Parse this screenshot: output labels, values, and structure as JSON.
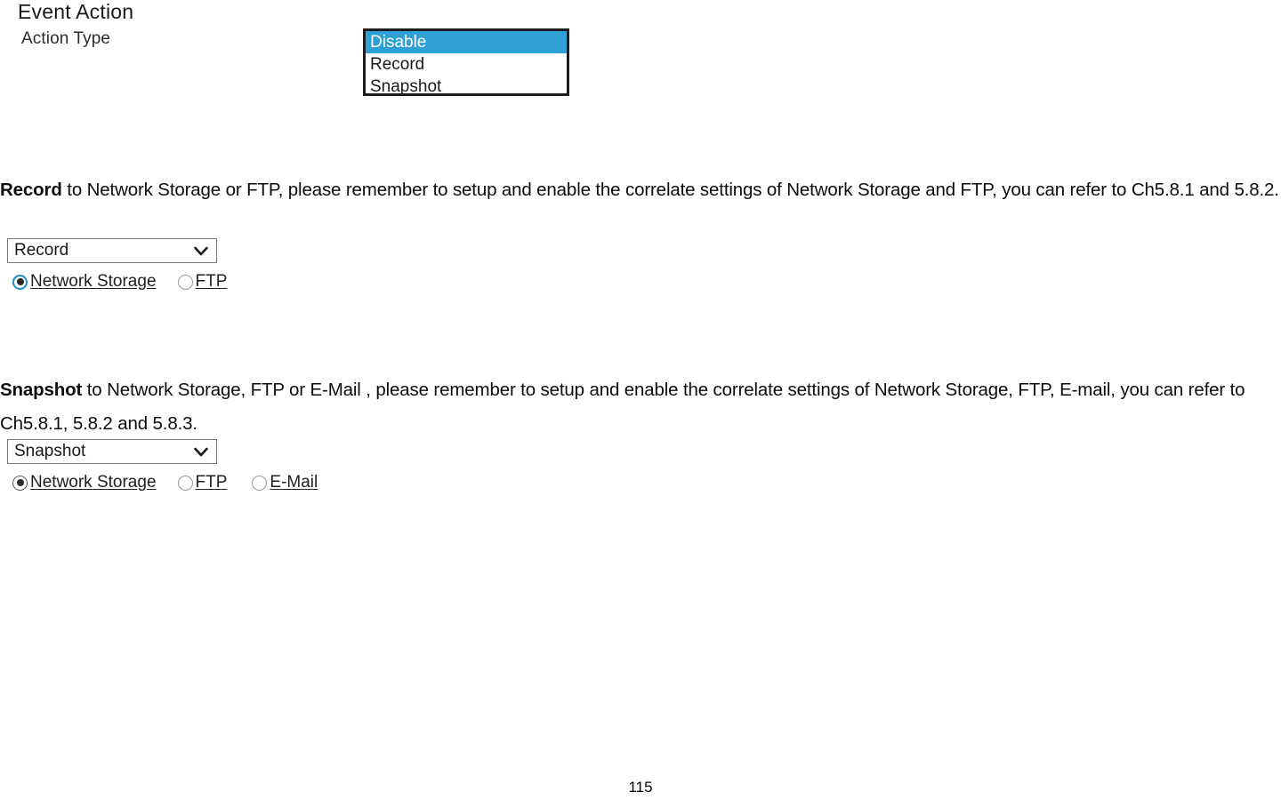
{
  "document": {
    "page_number": "115"
  },
  "ui_panel": {
    "heading": "Event Action",
    "field_label": "Action Type",
    "action_type_listbox": {
      "selected": "Disable",
      "options": [
        "Disable",
        "Record",
        "Snapshot"
      ],
      "highlight_color": "#2fa0d6",
      "highlight_text_color": "#ffffff",
      "border_color": "#1c1c1c"
    }
  },
  "sections": [
    {
      "id": "record",
      "paragraph": {
        "lead": "Record",
        "rest": " to Network Storage or FTP, please remember to setup and enable the correlate settings of Network Storage and FTP, you can refer to Ch5.8.1 and 5.8.2."
      },
      "select": {
        "value": "Record",
        "arrow_icon": "chevron-down-icon"
      },
      "radios": [
        {
          "label": "Network Storage",
          "checked": true,
          "style": "on-blue"
        },
        {
          "label": "FTP",
          "checked": false,
          "style": "off"
        }
      ]
    },
    {
      "id": "snapshot",
      "paragraph": {
        "lead": "Snapshot",
        "rest": " to Network Storage, FTP or E-Mail , please remember to setup and enable the correlate settings of Network Storage, FTP, E-mail, you can refer to Ch5.8.1, 5.8.2 and 5.8.3."
      },
      "select": {
        "value": "Snapshot",
        "arrow_icon": "chevron-down-icon"
      },
      "radios": [
        {
          "label": "Network Storage",
          "checked": true,
          "style": "on-dark"
        },
        {
          "label": "FTP",
          "checked": false,
          "style": "off"
        },
        {
          "label": "E-Mail",
          "checked": false,
          "style": "off"
        }
      ]
    }
  ],
  "colors": {
    "selection_blue": "#2fa0d6",
    "radio_blue": "#1d8fd1",
    "select_border": "#767676",
    "text": "#0d0d0d"
  }
}
